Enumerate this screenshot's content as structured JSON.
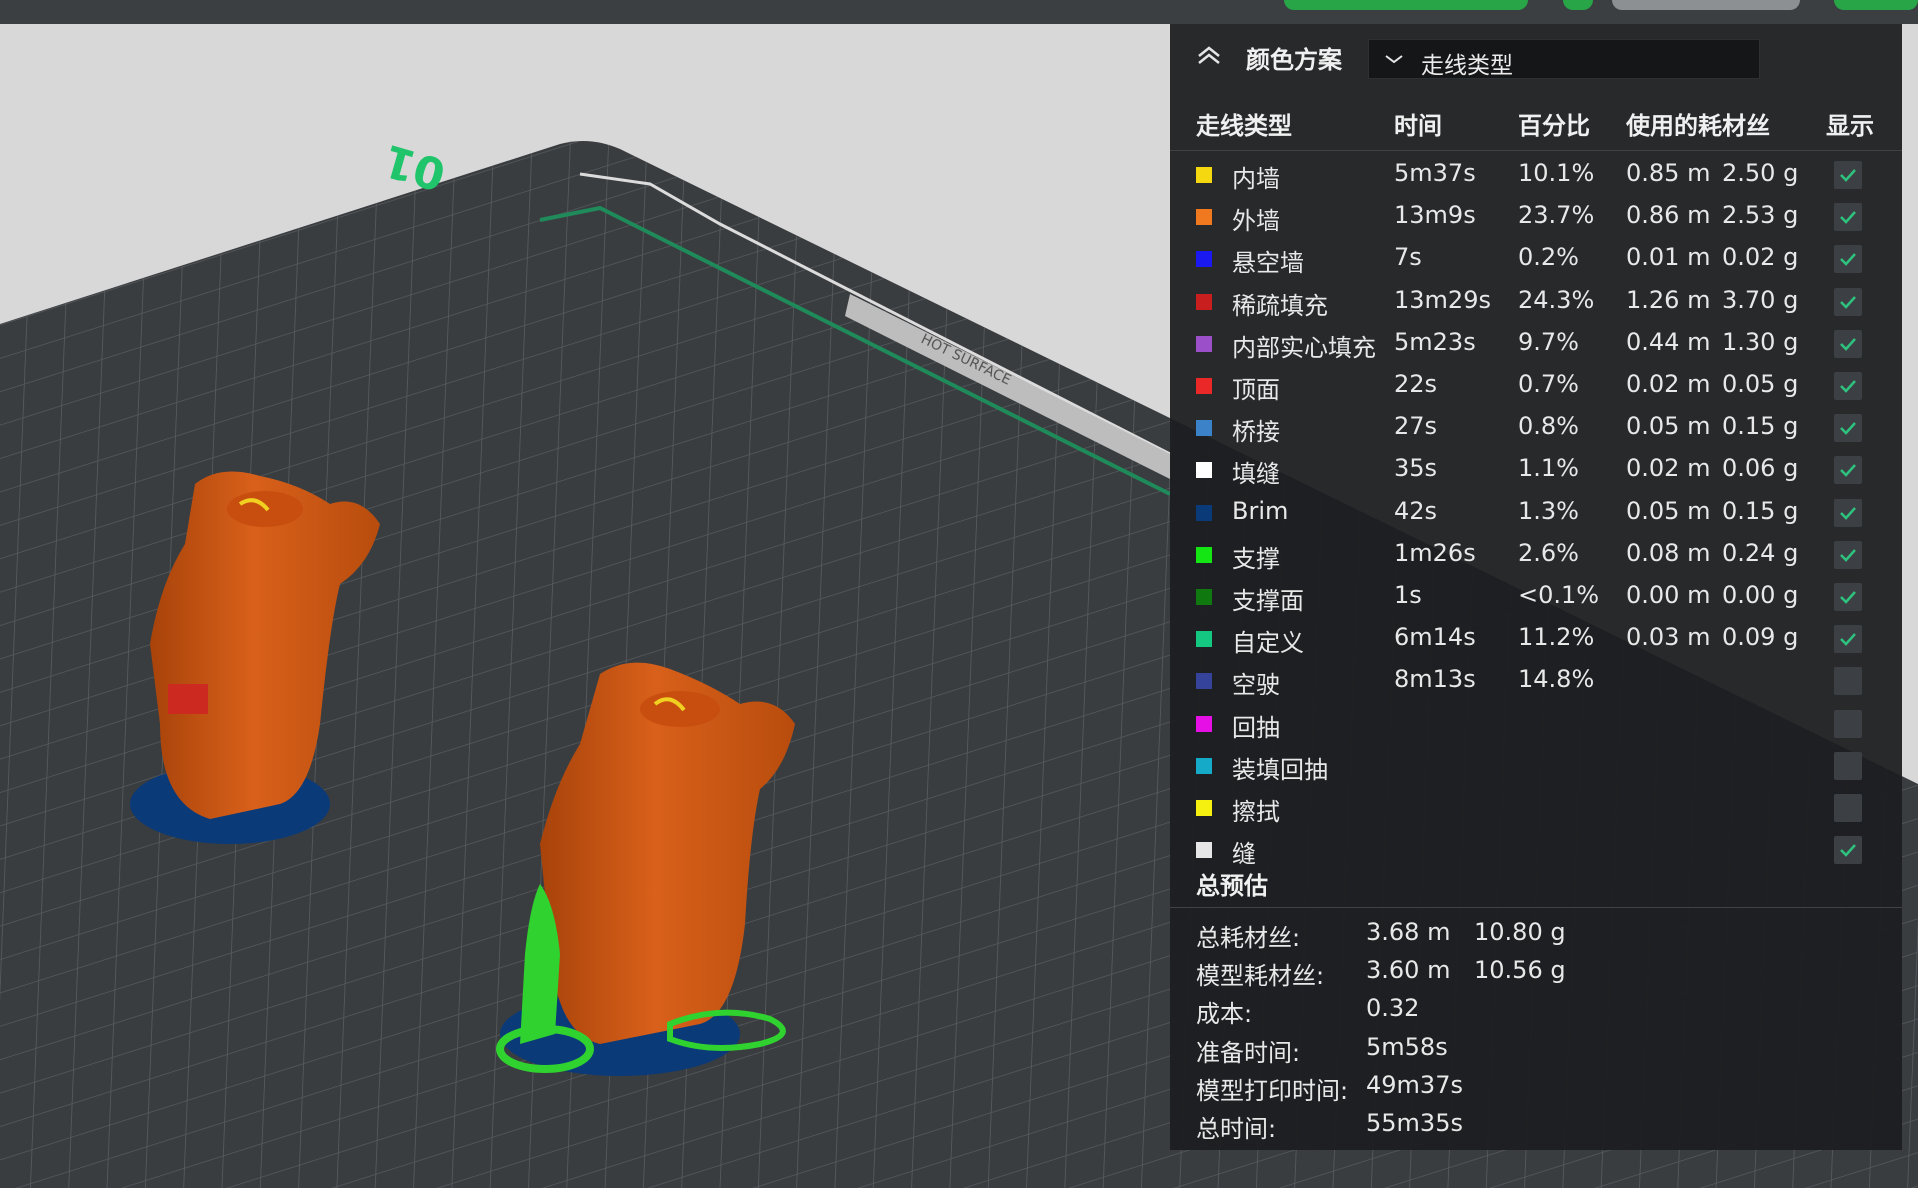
{
  "panel": {
    "header": {
      "title": "颜色方案",
      "selected_scheme": "走线类型"
    },
    "columns": {
      "line_type": "走线类型",
      "time": "时间",
      "percent": "百分比",
      "filament": "使用的耗材丝",
      "display": "显示"
    },
    "rows": [
      {
        "name": "内墙",
        "color": "#f5d80f",
        "time": "5m37s",
        "percent": "10.1%",
        "length": "0.85 m",
        "weight": "2.50 g",
        "shown": true
      },
      {
        "name": "外墙",
        "color": "#f0781e",
        "time": "13m9s",
        "percent": "23.7%",
        "length": "0.86 m",
        "weight": "2.53 g",
        "shown": true
      },
      {
        "name": "悬空墙",
        "color": "#1a1af0",
        "time": "7s",
        "percent": "0.2%",
        "length": "0.01 m",
        "weight": "0.02 g",
        "shown": true
      },
      {
        "name": "稀疏填充",
        "color": "#c81e1e",
        "time": "13m29s",
        "percent": "24.3%",
        "length": "1.26 m",
        "weight": "3.70 g",
        "shown": true
      },
      {
        "name": "内部实心填充",
        "color": "#9b4fc8",
        "time": "5m23s",
        "percent": "9.7%",
        "length": "0.44 m",
        "weight": "1.30 g",
        "shown": true
      },
      {
        "name": "顶面",
        "color": "#eb2828",
        "time": "22s",
        "percent": "0.7%",
        "length": "0.02 m",
        "weight": "0.05 g",
        "shown": true
      },
      {
        "name": "桥接",
        "color": "#3c82c8",
        "time": "27s",
        "percent": "0.8%",
        "length": "0.05 m",
        "weight": "0.15 g",
        "shown": true
      },
      {
        "name": "填缝",
        "color": "#ffffff",
        "time": "35s",
        "percent": "1.1%",
        "length": "0.02 m",
        "weight": "0.06 g",
        "shown": true
      },
      {
        "name": "Brim",
        "color": "#0b3a78",
        "time": "42s",
        "percent": "1.3%",
        "length": "0.05 m",
        "weight": "0.15 g",
        "shown": true
      },
      {
        "name": "支撑",
        "color": "#14e614",
        "time": "1m26s",
        "percent": "2.6%",
        "length": "0.08 m",
        "weight": "0.24 g",
        "shown": true
      },
      {
        "name": "支撑面",
        "color": "#0f780f",
        "time": "1s",
        "percent": "<0.1%",
        "length": "0.00 m",
        "weight": "0.00 g",
        "shown": true
      },
      {
        "name": "自定义",
        "color": "#14c882",
        "time": "6m14s",
        "percent": "11.2%",
        "length": "0.03 m",
        "weight": "0.09 g",
        "shown": true
      },
      {
        "name": "空驶",
        "color": "#35439b",
        "time": "8m13s",
        "percent": "14.8%",
        "length": "",
        "weight": "",
        "shown": false
      },
      {
        "name": "回抽",
        "color": "#e60fe6",
        "time": "",
        "percent": "",
        "length": "",
        "weight": "",
        "shown": false
      },
      {
        "name": "装填回抽",
        "color": "#14aac8",
        "time": "",
        "percent": "",
        "length": "",
        "weight": "",
        "shown": false
      },
      {
        "name": "擦拭",
        "color": "#f5f00f",
        "time": "",
        "percent": "",
        "length": "",
        "weight": "",
        "shown": false
      },
      {
        "name": "缝",
        "color": "#e6e6e6",
        "time": "",
        "percent": "",
        "length": "",
        "weight": "",
        "shown": true
      }
    ],
    "summary": {
      "title": "总预估",
      "rows": [
        {
          "label": "总耗材丝:",
          "value1": "3.68 m",
          "value2": "10.80 g"
        },
        {
          "label": "模型耗材丝:",
          "value1": "3.60 m",
          "value2": "10.56 g"
        },
        {
          "label": "成本:",
          "value1": "0.32",
          "value2": ""
        },
        {
          "label": "准备时间:",
          "value1": "5m58s",
          "value2": ""
        },
        {
          "label": "模型打印时间:",
          "value1": "49m37s",
          "value2": ""
        },
        {
          "label": "总时间:",
          "value1": "55m35s",
          "value2": ""
        }
      ]
    }
  },
  "plate": {
    "corner_label": "01",
    "surface_label": "HOT SURFACE"
  },
  "colors": {
    "accent_green": "#27a547",
    "check_green": "#2ec27e",
    "plate_dark": "#3a3d40",
    "grid_line": "#55595c",
    "model_orange": "#d35a10",
    "support_green": "#2fd22f",
    "brim_blue": "#0b3a78"
  }
}
